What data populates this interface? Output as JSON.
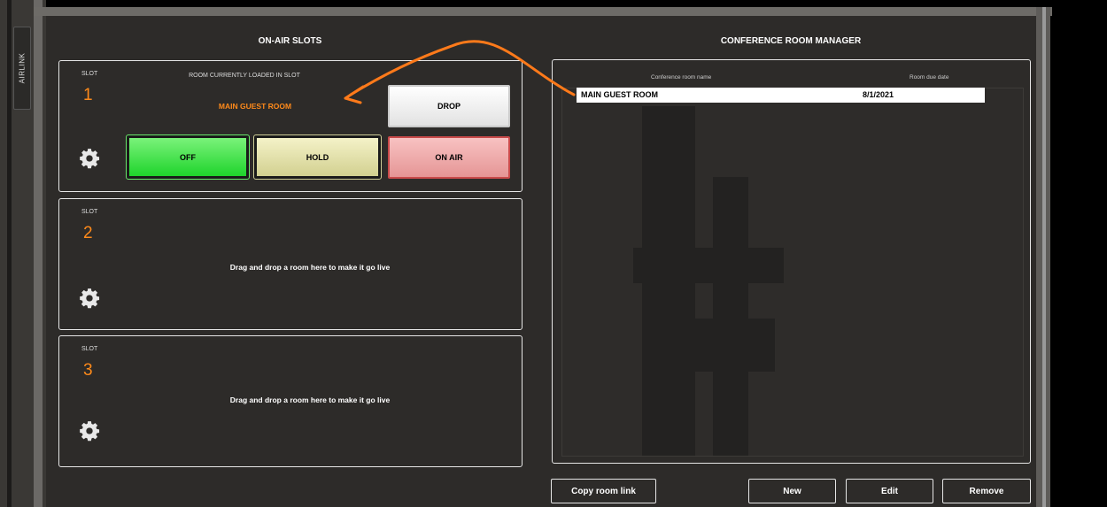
{
  "side_tab": {
    "label": "AIRLINK"
  },
  "on_air": {
    "title": "ON-AIR SLOTS",
    "slots": [
      {
        "slot_label": "SLOT",
        "number": "1",
        "room_caption": "ROOM CURRENTLY LOADED IN SLOT",
        "room_name": "MAIN GUEST ROOM",
        "buttons": {
          "drop": "DROP",
          "off": "OFF",
          "hold": "HOLD",
          "on_air": "ON AIR"
        }
      },
      {
        "slot_label": "SLOT",
        "number": "2",
        "drag_text": "Drag and drop a room here to make it go live"
      },
      {
        "slot_label": "SLOT",
        "number": "3",
        "drag_text": "Drag and drop a room here to make it go live"
      }
    ]
  },
  "manager": {
    "title": "CONFERENCE ROOM MANAGER",
    "columns": [
      "Conference room name",
      "Room due date"
    ],
    "rows": [
      {
        "name": "MAIN GUEST ROOM",
        "due_date": "8/1/2021"
      }
    ]
  },
  "bottom_buttons": {
    "copy_link": "Copy room link",
    "new": "New",
    "edit": "Edit",
    "remove": "Remove"
  },
  "colors": {
    "accent_orange": "#ff8a1a",
    "panel_bg": "#2d2b29",
    "off_green": "#1fd42c",
    "hold_yellow": "#d2d090",
    "on_air_red": "#e59595"
  },
  "icons": [
    "gear-icon",
    "arrow-annotation-icon"
  ]
}
